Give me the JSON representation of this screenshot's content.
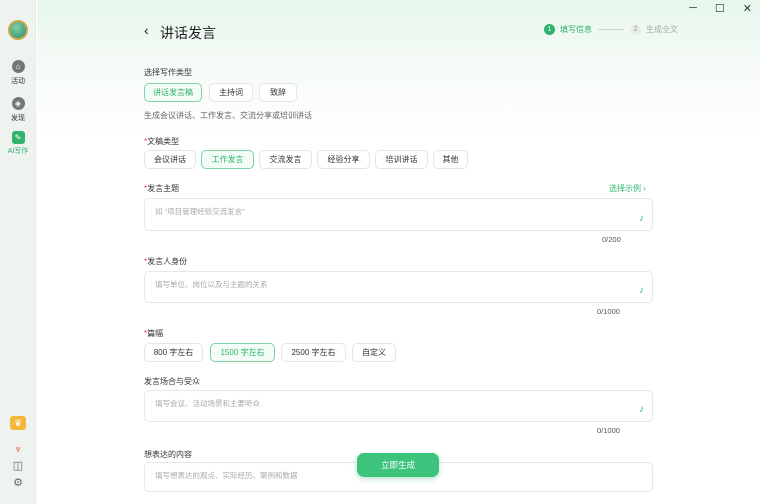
{
  "sidebar": {
    "items": [
      {
        "label": "活动",
        "icon": "home-icon"
      },
      {
        "label": "发现",
        "icon": "compass-icon"
      },
      {
        "label": "AI写作",
        "icon": "ai-write-icon"
      }
    ]
  },
  "window": {
    "minimize": "─",
    "maximize": "☐",
    "close": "✕"
  },
  "header": {
    "back_icon": "‹",
    "title": "讲话发言",
    "steps": [
      {
        "num": "1",
        "label": "填写信息",
        "active": true
      },
      {
        "num": "2",
        "label": "生成全文",
        "active": false
      }
    ]
  },
  "form": {
    "type_label": "选择写作类型",
    "types": [
      "讲话发言稿",
      "主持词",
      "致辞"
    ],
    "type_selected": "讲话发言稿",
    "type_hint": "生成会议讲话、工作发言、交流分享或培训讲话",
    "doc_type_label": "文稿类型",
    "doc_types": [
      "会议讲话",
      "工作发言",
      "交流发言",
      "经验分享",
      "培训讲话",
      "其他"
    ],
    "doc_type_selected": "工作发言",
    "topic_label": "发言主题",
    "topic_example_link": "选择示例 ›",
    "topic_placeholder": "如 “项目管理经验交流发言”",
    "topic_counter": "0/200",
    "identity_label": "发言人身份",
    "identity_placeholder": "填写单位、岗位以及与主题的关系",
    "identity_counter": "0/1000",
    "length_label": "篇幅",
    "lengths": [
      "800 字左右",
      "1500 字左右",
      "2500 字左右",
      "自定义"
    ],
    "length_selected": "1500 字左右",
    "occasion_label": "发言场合与受众",
    "occasion_placeholder": "填写会议、活动场景和主要听众",
    "occasion_counter": "0/1000",
    "content_label": "想表达的内容",
    "content_placeholder": "填写想表达的观点、实际经历、案例和数据",
    "generate_button": "立即生成"
  },
  "colors": {
    "accent": "#2fb36d",
    "required": "#ee3333"
  }
}
